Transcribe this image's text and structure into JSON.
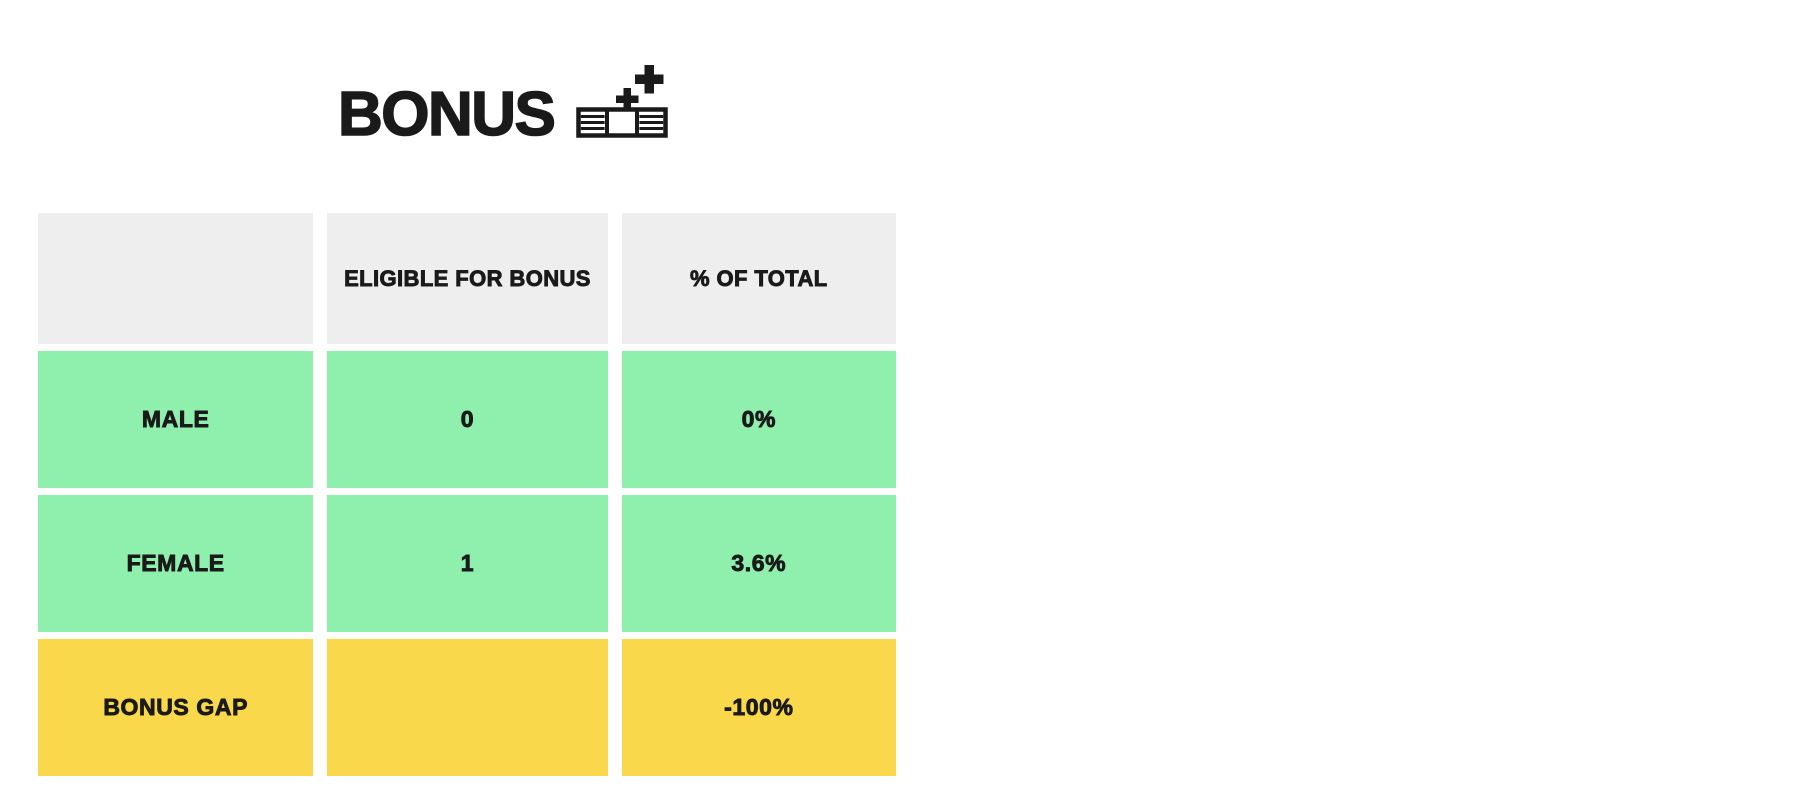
{
  "header": {
    "title": "BONUS",
    "icon_name": "banknote-sparkle-icon"
  },
  "table": {
    "name": "bonus-gender-table",
    "columns": [
      {
        "key": "label",
        "header": ""
      },
      {
        "key": "count",
        "header": "ELIGIBLE FOR BONUS"
      },
      {
        "key": "pct",
        "header": "% OF TOTAL"
      }
    ],
    "rows": [
      {
        "label": "MALE",
        "count": "0",
        "pct": "0%",
        "tone": "green"
      },
      {
        "label": "FEMALE",
        "count": "1",
        "pct": "3.6%",
        "tone": "green"
      },
      {
        "label": "BONUS GAP",
        "count": "",
        "pct": "-100%",
        "tone": "yellow"
      }
    ]
  },
  "colors": {
    "green": "#8ff0ae",
    "yellow": "#fad84b",
    "header_gray": "#eeeeee",
    "text": "#1a1a1a",
    "background": "#ffffff"
  },
  "chart_data": {
    "type": "table",
    "title": "BONUS",
    "categories": [
      "MALE",
      "FEMALE",
      "BONUS GAP"
    ],
    "series": [
      {
        "name": "ELIGIBLE FOR BONUS",
        "values": [
          0,
          1,
          null
        ]
      },
      {
        "name": "% OF TOTAL",
        "values": [
          0,
          3.6,
          -100
        ]
      }
    ],
    "xlabel": "",
    "ylabel": "",
    "legend": "none",
    "grid": false
  }
}
